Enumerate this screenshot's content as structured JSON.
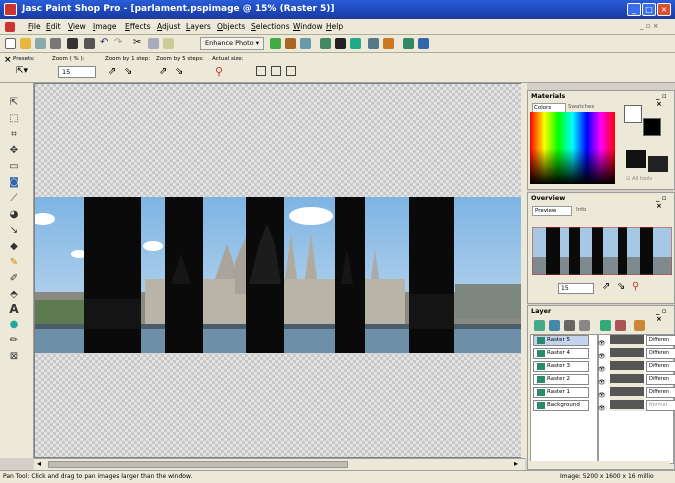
{
  "window": {
    "title": "Jasc Paint Shop Pro - [parlament.pspimage @ 15% (Raster 5)]"
  },
  "menu": [
    "File",
    "Edit",
    "View",
    "Image",
    "Effects",
    "Adjust",
    "Layers",
    "Objects",
    "Selections",
    "Window",
    "Help"
  ],
  "toolbar": {
    "enhance_photo": "Enhance Photo"
  },
  "tool_options": {
    "presets_label": "Presets:",
    "zoom_label": "Zoom ( % ):",
    "zoom_value": "15",
    "zoom_step1_label": "Zoom by 1 step:",
    "zoom_step5_label": "Zoom by 5 steps:",
    "actual_size_label": "Actual size:"
  },
  "panels": {
    "materials": {
      "title": "Materials",
      "tab_colors": "Colors",
      "tab_swatches": "Swatches",
      "all_tools": "All tools"
    },
    "overview": {
      "title": "Overview",
      "tab_preview": "Preview",
      "tab_info": "Info",
      "zoom_value": "15"
    },
    "layers": {
      "title": "Layer",
      "rows": [
        {
          "name": "Raster 5",
          "mode": "Differen"
        },
        {
          "name": "Raster 4",
          "mode": "Differen"
        },
        {
          "name": "Raster 3",
          "mode": "Differen"
        },
        {
          "name": "Raster 2",
          "mode": "Differen"
        },
        {
          "name": "Raster 1",
          "mode": "Differen"
        },
        {
          "name": "Background",
          "mode": "Normal"
        }
      ]
    }
  },
  "status": {
    "hint": "Pan Tool: Click and drag to pan images larger than the window.",
    "image_info": "Image: 5200 x 1600 x 16 millio"
  },
  "colors": {
    "title_bar": "#1e46b8",
    "workspace_check": "#c8c8c8",
    "sky": "#9ec8e8",
    "water": "#6e8fa8"
  }
}
